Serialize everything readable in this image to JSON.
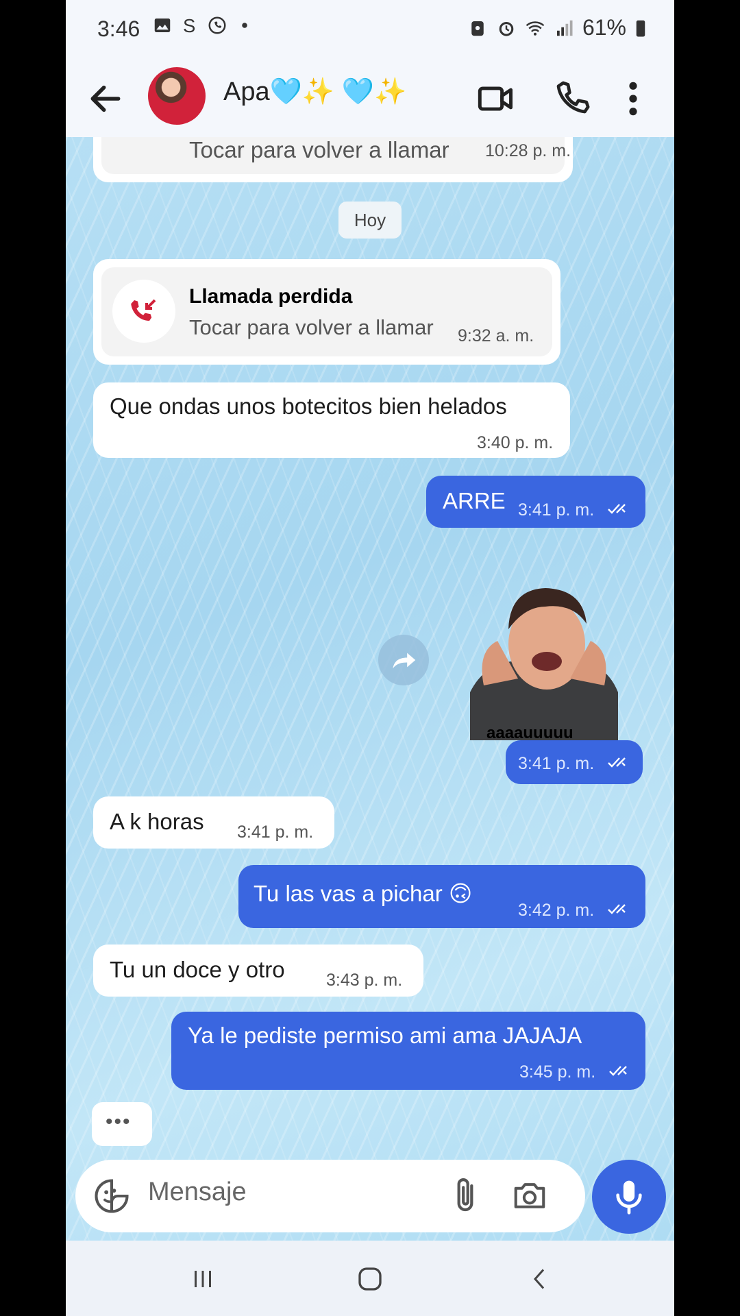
{
  "status": {
    "time": "3:46",
    "battery": "61%"
  },
  "header": {
    "contact_name": "Apa🩵✨ 🩵✨"
  },
  "chat": {
    "top_missed_partial": {
      "subtitle": "Tocar para volver a llamar",
      "time": "10:28 p. m."
    },
    "date_chip": "Hoy",
    "missed_call": {
      "title": "Llamada perdida",
      "subtitle": "Tocar para volver a llamar",
      "time": "9:32 a. m."
    },
    "messages": [
      {
        "dir": "in",
        "text": "Que ondas unos botecitos bien helados",
        "time": "3:40 p. m."
      },
      {
        "dir": "out",
        "text": "ARRE",
        "time": "3:41 p. m."
      },
      {
        "dir": "out",
        "text": "",
        "sticker_caption": "aaaauuuuu",
        "time": "3:41 p. m."
      },
      {
        "dir": "in",
        "text": "A k horas",
        "time": "3:41 p. m."
      },
      {
        "dir": "out",
        "text": "Tu las vas a pichar 🙃",
        "time": "3:42 p. m."
      },
      {
        "dir": "in",
        "text": "Tu un doce y otro",
        "time": "3:43 p. m."
      },
      {
        "dir": "out",
        "text": "Ya le pediste permiso ami ama JAJAJA",
        "time": "3:45 p. m."
      }
    ],
    "typing_indicator": "•••"
  },
  "composer": {
    "placeholder": "Mensaje"
  },
  "colors": {
    "outgoing": "#3a66e0",
    "missed_icon": "#d1223a"
  }
}
